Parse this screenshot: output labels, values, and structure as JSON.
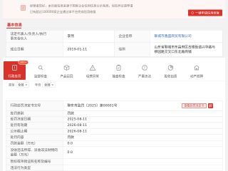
{
  "banner": {
    "line1": "经营者您好，本页面信息来源于国家企业信用信息公示系统，如有异议请申请",
    "line2": "已有超过100000家企业通过本平台完成信用修复",
    "button_label": "一键申请信用修复",
    "icon": "document-icon",
    "button_icon": "shield-icon"
  },
  "basic_info": {
    "title": "基本信息",
    "legal_rep_label": "法定代表人/负责人/执行事务合伙人",
    "legal_rep_value": "李然",
    "company_name_label": "企业名称",
    "company_name_value": "聊城市鑫盛商贸有限公司",
    "established_label": "成立日期",
    "established_value": "2019-01-11",
    "address_label": "住所",
    "address_value": "山东省聊城市东昌府区古楼街道兴华路与柳园路交叉口东北角商铺"
  },
  "tabs": {
    "selected_index": 0,
    "selected_badge": "100+",
    "items": [
      {
        "label": "行政处罚",
        "icon": "penalty-document-icon"
      },
      {
        "label": "监督检查",
        "icon": "magnifier-icon"
      },
      {
        "label": "产品召回",
        "icon": "box-icon"
      },
      {
        "label": "经营异常",
        "icon": "warning-icon"
      },
      {
        "label": "抽查检查",
        "icon": "clipboard-check-icon"
      },
      {
        "label": "严重违法",
        "icon": "alert-circle-icon"
      },
      {
        "label": "股权出质",
        "icon": "pie-chart-icon"
      },
      {
        "label": "动产抵押",
        "icon": "house-icon"
      }
    ]
  },
  "filters": {
    "type_label": "类型",
    "type_value": "全部",
    "year_label": "年份",
    "year_value": "全部"
  },
  "penalty_detail": {
    "view_button_label": "查看处罚决定书",
    "rows": [
      {
        "label": "行政处罚决定书文号",
        "value": "聊东市监罚〔2025〕第00001号"
      },
      {
        "label": "处罚类别",
        "value": "罚款"
      },
      {
        "label": "处罚决定日期",
        "value": "2025-08-11"
      },
      {
        "label": "处罚有效期",
        "value": "2026-08-11"
      },
      {
        "label": "公示截止期",
        "value": "2026-08-11"
      },
      {
        "label": "处罚内容",
        "value": "罚款"
      },
      {
        "label": "罚款金额（万元）",
        "value": "0.0"
      },
      {
        "label": "没收违法所得、没收非法财物的金额（万元）",
        "value": "0.0"
      },
      {
        "label": "暂扣或吊销证照名称及编号",
        "value": ""
      },
      {
        "label": "违法行为类型",
        "value": ""
      }
    ]
  },
  "colors": {
    "accent": "#d8322b",
    "border": "#e8e8e8",
    "label_bg": "#fafafa",
    "link": "#3d6fb6"
  }
}
